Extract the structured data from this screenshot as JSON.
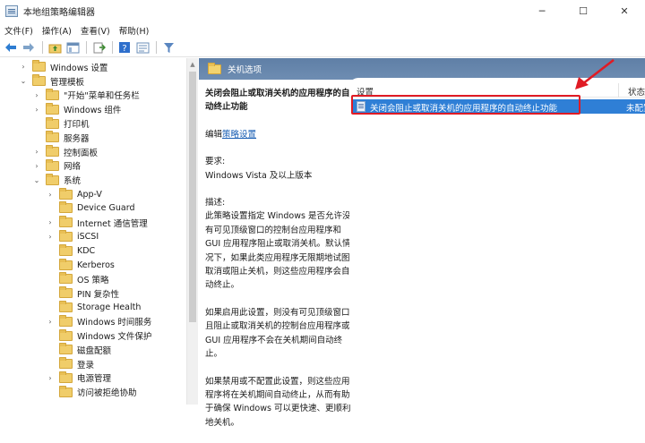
{
  "window": {
    "title": "本地组策略编辑器",
    "minimize": "─",
    "maximize": "☐",
    "close": "✕"
  },
  "menu": [
    "文件(F)",
    "操作(A)",
    "查看(V)",
    "帮助(H)"
  ],
  "toolbar": {
    "back_icon": "arrow-left-icon",
    "forward_icon": "arrow-right-icon",
    "up_icon": "folder-up-icon",
    "console_icon": "console-tree-icon",
    "export_icon": "export-list-icon",
    "help_icon": "help-icon",
    "properties_icon": "properties-icon",
    "filter_icon": "filter-icon"
  },
  "tree": [
    {
      "label": "Windows 设置",
      "level": 2,
      "expander": "›"
    },
    {
      "label": "管理模板",
      "level": 2,
      "expander": "⌄"
    },
    {
      "label": "\"开始\"菜单和任务栏",
      "level": 3,
      "expander": "›"
    },
    {
      "label": "Windows 组件",
      "level": 3,
      "expander": "›"
    },
    {
      "label": "打印机",
      "level": 3,
      "expander": ""
    },
    {
      "label": "服务器",
      "level": 3,
      "expander": ""
    },
    {
      "label": "控制面板",
      "level": 3,
      "expander": "›"
    },
    {
      "label": "网络",
      "level": 3,
      "expander": "›"
    },
    {
      "label": "系统",
      "level": 3,
      "expander": "⌄"
    },
    {
      "label": "App-V",
      "level": 4,
      "expander": "›"
    },
    {
      "label": "Device Guard",
      "level": 4,
      "expander": ""
    },
    {
      "label": "Internet 通信管理",
      "level": 4,
      "expander": "›"
    },
    {
      "label": "iSCSI",
      "level": 4,
      "expander": "›"
    },
    {
      "label": "KDC",
      "level": 4,
      "expander": ""
    },
    {
      "label": "Kerberos",
      "level": 4,
      "expander": ""
    },
    {
      "label": "OS 策略",
      "level": 4,
      "expander": ""
    },
    {
      "label": "PIN 复杂性",
      "level": 4,
      "expander": ""
    },
    {
      "label": "Storage Health",
      "level": 4,
      "expander": ""
    },
    {
      "label": "Windows 时间服务",
      "level": 4,
      "expander": "›"
    },
    {
      "label": "Windows 文件保护",
      "level": 4,
      "expander": ""
    },
    {
      "label": "磁盘配额",
      "level": 4,
      "expander": ""
    },
    {
      "label": "登录",
      "level": 4,
      "expander": ""
    },
    {
      "label": "电源管理",
      "level": 4,
      "expander": "›"
    },
    {
      "label": "访问被拒绝协助",
      "level": 4,
      "expander": ""
    }
  ],
  "section": {
    "title": "关机选项"
  },
  "description": {
    "policy_title": "关闭会阻止或取消关机的应用程序的自动终止功能",
    "edit_prefix": "编辑",
    "edit_link": "策略设置",
    "requirements_label": "要求:",
    "requirements_value": "Windows Vista 及以上版本",
    "description_label": "描述:",
    "paragraph1": "此策略设置指定 Windows 是否允许没有可见顶级窗口的控制台应用程序和 GUI 应用程序阻止或取消关机。默认情况下，如果此类应用程序无限期地试图取消或阻止关机，则这些应用程序会自动终止。",
    "paragraph2": "如果启用此设置，则没有可见顶级窗口且阻止或取消关机的控制台应用程序或 GUI 应用程序不会在关机期间自动终止。",
    "paragraph3": "如果禁用或不配置此设置，则这些应用程序将在关机期间自动终止，从而有助于确保 Windows 可以更快速、更顺利地关机。"
  },
  "list": {
    "col_setting": "设置",
    "col_state": "状态",
    "rows": [
      {
        "setting": "关闭会阻止或取消关机的应用程序的自动终止功能",
        "state": "未配置"
      }
    ]
  },
  "colors": {
    "selection": "#2f7fd6",
    "header": "#6783aa",
    "annotation": "#e01b24"
  }
}
